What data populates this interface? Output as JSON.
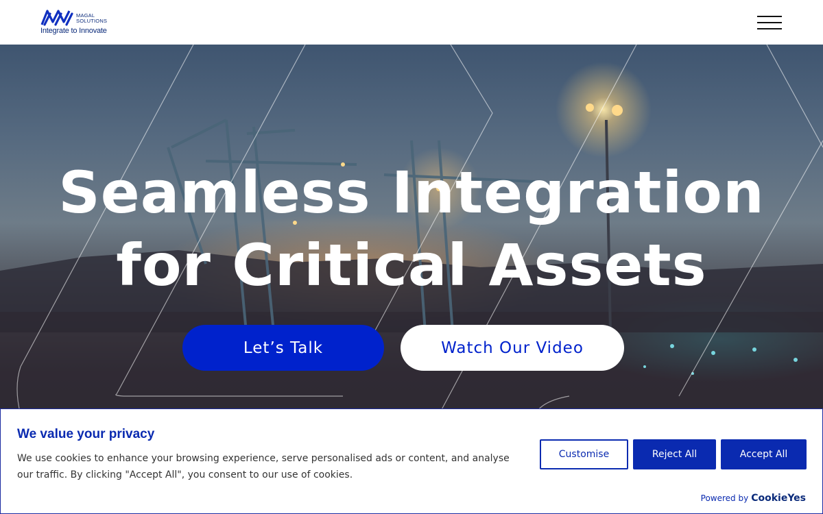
{
  "header": {
    "logo": {
      "name_line1": "MAGAL",
      "name_line2": "SOLUTIONS",
      "tagline": "Integrate to Innovate",
      "brand_color": "#0a2a7a"
    },
    "menu_icon": "hamburger-menu-icon"
  },
  "hero": {
    "title_line1": "Seamless Integration",
    "title_line2": "for Critical Assets",
    "primary_button": "Let’s Talk",
    "secondary_button": "Watch Our Video",
    "accent_color": "#0022cc"
  },
  "cookie_banner": {
    "title": "We value your privacy",
    "text": "We use cookies to enhance your browsing experience, serve personalised ads or content, and analyse our traffic. By clicking \"Accept All\", you consent to our use of cookies.",
    "customise_label": "Customise",
    "reject_label": "Reject All",
    "accept_label": "Accept All",
    "powered_by": "Powered by",
    "brand": "CookieYes",
    "accent_color": "#0a2ab0"
  }
}
